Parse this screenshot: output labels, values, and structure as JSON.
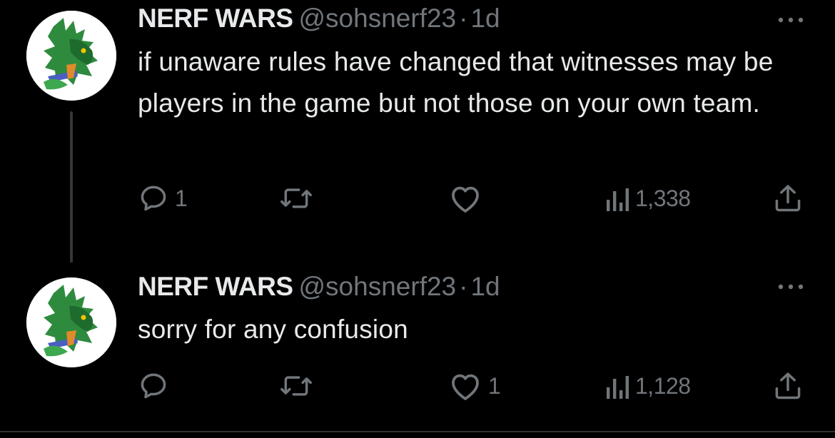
{
  "tweets": [
    {
      "display_name": "NERF WARS",
      "handle": "@sohsnerf23",
      "separator": "·",
      "time": "1d",
      "text": "if unaware rules have changed that witnesses may be players in the game but not those on your own team.",
      "actions": {
        "reply_count": "1",
        "retweet_count": "",
        "like_count": "",
        "views_count": "1,338"
      }
    },
    {
      "display_name": "NERF WARS",
      "handle": "@sohsnerf23",
      "separator": "·",
      "time": "1d",
      "text": "sorry for any confusion",
      "actions": {
        "reply_count": "",
        "retweet_count": "",
        "like_count": "1",
        "views_count": "1,128"
      }
    }
  ],
  "icons": {
    "reply": "reply-icon",
    "retweet": "retweet-icon",
    "like": "heart-icon",
    "views": "views-icon",
    "share": "share-icon",
    "more": "more-icon",
    "avatar": "dragon-avatar"
  },
  "colors": {
    "background": "#000000",
    "primary_text": "#e7e9ea",
    "secondary_text": "#71767b",
    "thread_line": "#333639",
    "avatar_dragon": "#2e8b3e"
  }
}
